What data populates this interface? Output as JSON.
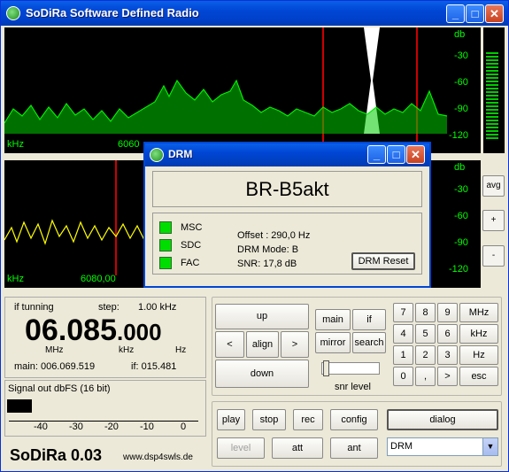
{
  "app": {
    "title": "SoDiRa Software Defined Radio"
  },
  "spectrum_top": {
    "unit_left": "kHz",
    "freq_label": "6060",
    "db_unit": "db",
    "db_ticks": [
      "-30",
      "-60",
      "-90",
      "-120"
    ]
  },
  "spectrum_bottom": {
    "unit_left": "kHz",
    "freq_label": "6080,00",
    "db_unit": "db",
    "db_ticks": [
      "-30",
      "-60",
      "-90",
      "-120"
    ]
  },
  "side_buttons": {
    "avg": "avg",
    "plus": "+",
    "minus": "-"
  },
  "drm_dialog": {
    "title": "DRM",
    "station": "BR-B5akt",
    "indicators": [
      "MSC",
      "SDC",
      "FAC"
    ],
    "offset": "Offset : 290,0 Hz",
    "mode": "DRM Mode: B",
    "snr": "SNR: 17,8 dB",
    "reset_label": "DRM Reset"
  },
  "freq_panel": {
    "if_tuning": "if tunning",
    "step_label": "step:",
    "step_value": "1.00  kHz",
    "freq_main": "06.085",
    "freq_fine": ".000",
    "unit_mhz": "MHz",
    "unit_khz": "kHz",
    "unit_hz": "Hz",
    "main_label": "main: 006.069.519",
    "if_label": "if:  015.481"
  },
  "signal_meter": {
    "title": "Signal out dbFS (16 bit)",
    "ticks": [
      "-40",
      "-30",
      "-20",
      "-10",
      "0"
    ]
  },
  "brand": {
    "name": "SoDiRa 0.03",
    "url": "www.dsp4swls.de"
  },
  "nav": {
    "up": "up",
    "left": "<",
    "align": "align",
    "right": ">",
    "down": "down"
  },
  "mode_buttons": {
    "main": "main",
    "if": "if",
    "mirror": "mirror",
    "search": "search"
  },
  "snr_label": "snr level",
  "keypad": [
    [
      "7",
      "8",
      "9",
      "MHz"
    ],
    [
      "4",
      "5",
      "6",
      "kHz"
    ],
    [
      "1",
      "2",
      "3",
      "Hz"
    ],
    [
      "0",
      ",",
      ">",
      "esc"
    ]
  ],
  "actions": {
    "play": "play",
    "stop": "stop",
    "rec": "rec",
    "config": "config",
    "dialog": "dialog",
    "level": "level",
    "att": "att",
    "ant": "ant"
  },
  "mode_select": {
    "value": "DRM"
  }
}
